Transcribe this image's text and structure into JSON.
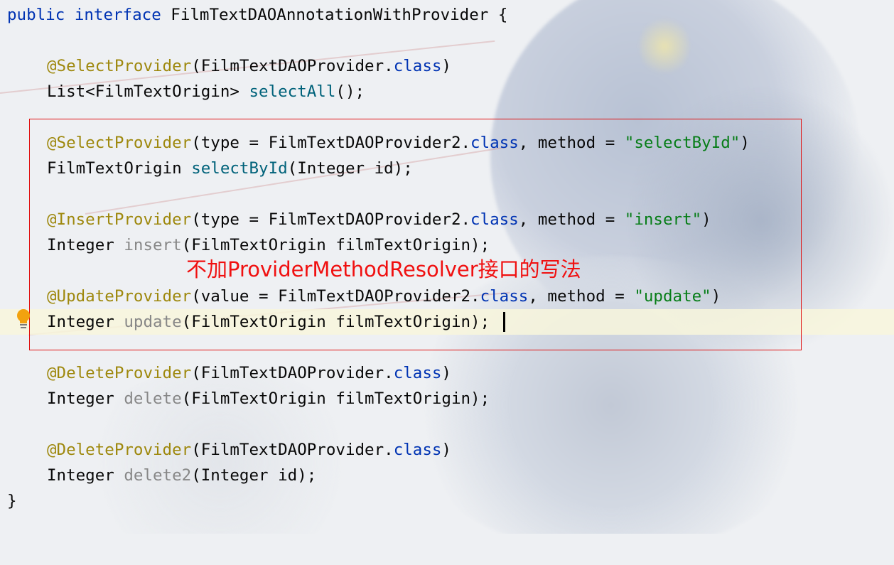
{
  "editor": {
    "lines": {
      "l1": {
        "kw": "public interface",
        "rest": " FilmTextDAOAnnotationWithProvider {"
      },
      "l3": {
        "ann": "@SelectProvider",
        "a": "(FilmTextDAOProvider.",
        "kw": "class",
        "b": ")"
      },
      "l4": {
        "a": "List<FilmTextOrigin> ",
        "mth": "selectAll",
        "b": "();"
      },
      "l6": {
        "ann": "@SelectProvider",
        "a": "(type = FilmTextDAOProvider2.",
        "kw": "class",
        "b": ", method = ",
        "str": "\"selectById\"",
        "c": ")"
      },
      "l7": {
        "a": "FilmTextOrigin ",
        "mth": "selectById",
        "b": "(Integer id);"
      },
      "l9": {
        "ann": "@InsertProvider",
        "a": "(type = FilmTextDAOProvider2.",
        "kw": "class",
        "b": ", method = ",
        "str": "\"insert\"",
        "c": ")"
      },
      "l10": {
        "a": "Integer ",
        "mth": "insert",
        "b": "(FilmTextOrigin filmTextOrigin);"
      },
      "l12": {
        "ann": "@UpdateProvider",
        "a": "(value = FilmTextDAOProvider2.",
        "kw": "class",
        "b": ", method = ",
        "str": "\"update\"",
        "c": ")"
      },
      "l13": {
        "a": "Integer ",
        "mth": "update",
        "b": "(FilmTextOrigin filmTextOrigin);"
      },
      "l15": {
        "ann": "@DeleteProvider",
        "a": "(FilmTextDAOProvider.",
        "kw": "class",
        "b": ")"
      },
      "l16": {
        "a": "Integer ",
        "mth": "delete",
        "b": "(FilmTextOrigin filmTextOrigin);"
      },
      "l18": {
        "ann": "@DeleteProvider",
        "a": "(FilmTextDAOProvider.",
        "kw": "class",
        "b": ")"
      },
      "l19": {
        "a": "Integer ",
        "mth": "delete2",
        "b": "(Integer id);"
      },
      "l20": {
        "a": "}"
      }
    },
    "annotation_note": "不加ProviderMethodResolver接口的写法",
    "icons": {
      "gutter": "lightbulb-icon"
    },
    "colors": {
      "keyword": "#0033b3",
      "annotation": "#9e880d",
      "string": "#067d17",
      "method": "#00627a",
      "unused_method": "#878787",
      "highlight_border": "#e01010",
      "note_text": "#f01010"
    }
  }
}
